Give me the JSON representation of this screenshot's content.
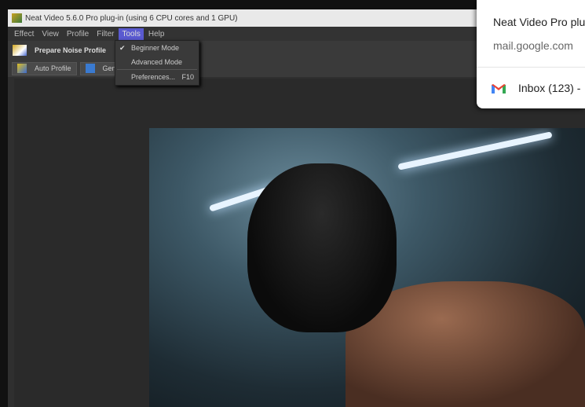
{
  "window": {
    "title": "Neat Video 5.6.0 Pro plug-in (using 6 CPU cores and 1 GPU)"
  },
  "menubar": [
    "Effect",
    "View",
    "Profile",
    "Filter",
    "Tools",
    "Help"
  ],
  "toolbar": {
    "prepare": "Prepare Noise Profile",
    "auto_profile": "Auto Profile",
    "generic": "Generi"
  },
  "tools_menu": {
    "items": [
      {
        "label": "Beginner Mode",
        "checked": true
      },
      {
        "label": "Advanced Mode"
      },
      {
        "label": "Preferences...",
        "shortcut": "F10"
      }
    ]
  },
  "notification": {
    "title": "Neat Video Pro plu",
    "source": "mail.google.com",
    "tab": "Inbox (123) -"
  }
}
